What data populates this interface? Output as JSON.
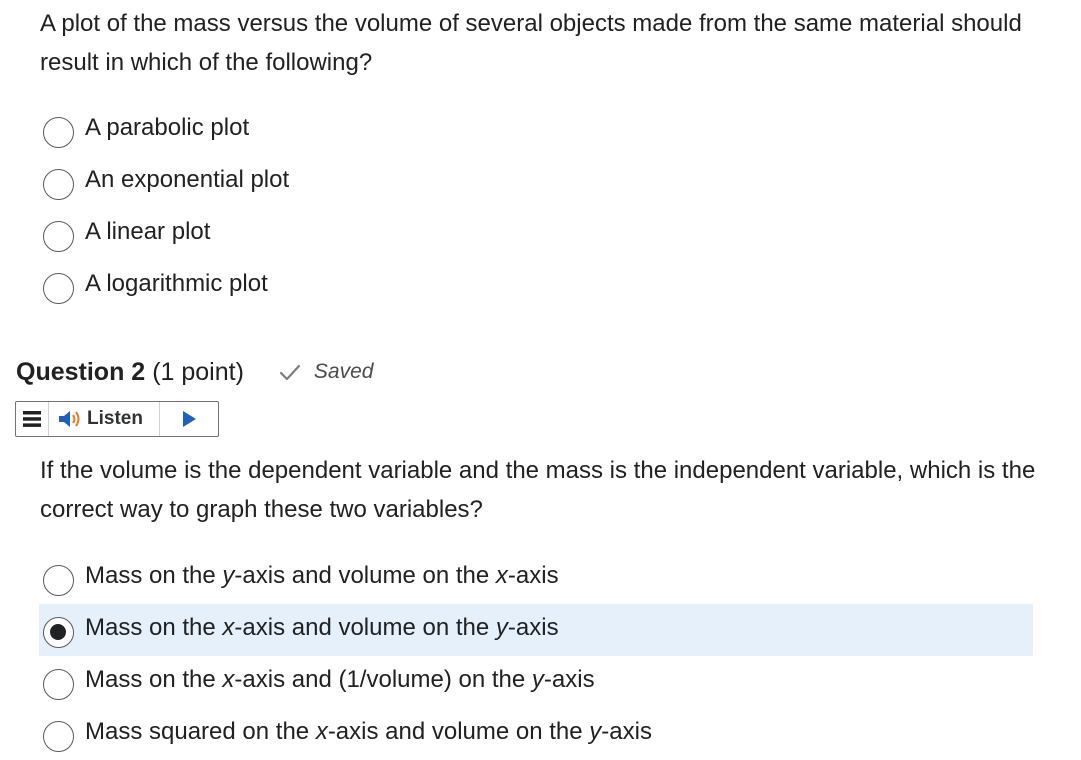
{
  "question1": {
    "text": "A plot of the mass versus the volume of several objects made from the same material should result in which of the following?",
    "options": [
      {
        "label": "A parabolic plot",
        "selected": false
      },
      {
        "label": "An exponential plot",
        "selected": false
      },
      {
        "label": "A linear plot",
        "selected": false
      },
      {
        "label": "A logarithmic plot",
        "selected": false
      }
    ]
  },
  "question2": {
    "title": "Question 2",
    "points": "(1 point)",
    "status": "Saved",
    "status_icon": "check-icon",
    "listen_label": "Listen",
    "text": "If the volume is the dependent variable and the mass is the independent variable, which is the correct way to graph these two variables?",
    "options": [
      {
        "parts": [
          "Mass on the ",
          "y",
          "-axis and volume on the ",
          "x",
          "-axis"
        ],
        "selected": false
      },
      {
        "parts": [
          "Mass on the ",
          "x",
          "-axis and volume on the ",
          "y",
          "-axis"
        ],
        "selected": true
      },
      {
        "parts": [
          "Mass on the ",
          "x",
          "-axis and (1/volume) on the ",
          "y",
          "-axis"
        ],
        "selected": false
      },
      {
        "parts": [
          "Mass squared on the ",
          "x",
          "-axis and volume on the ",
          "y",
          "-axis"
        ],
        "selected": false
      }
    ]
  },
  "colors": {
    "selected_background": "#e6f0fb",
    "check_color": "#7a7d80",
    "speaker_blue": "#1f5fbf",
    "speaker_orange": "#e57a1f",
    "play_blue": "#1f5fbf"
  }
}
